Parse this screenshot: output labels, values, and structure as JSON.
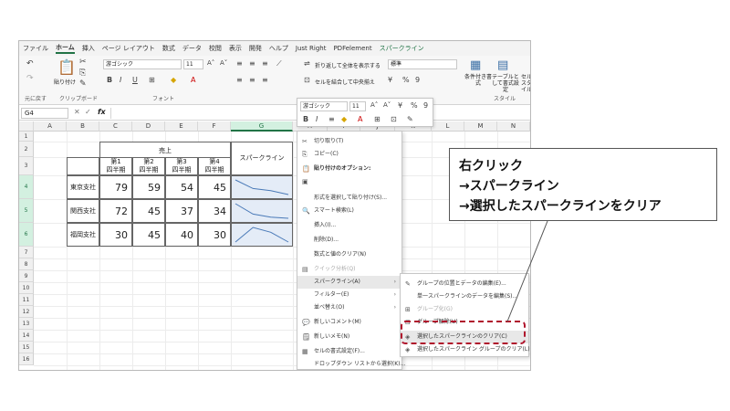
{
  "menu_tabs": [
    "ファイル",
    "ホーム",
    "挿入",
    "ページ レイアウト",
    "数式",
    "データ",
    "校閲",
    "表示",
    "開発",
    "ヘルプ",
    "Just Right",
    "PDFelement",
    "スパークライン"
  ],
  "ribbon": {
    "undo_label": "元に戻す",
    "clipboard_label": "クリップボード",
    "paste_label": "貼り付け",
    "font_label": "フォント",
    "style_label": "スタイル",
    "font_name": "游ゴシック",
    "font_size": "11",
    "wrap_text": "折り返して全体を表示する",
    "merge_center": "セルを結合して中央揃え",
    "number_format": "標準",
    "cond_format": "条件付き書式",
    "table_format": "テーブルとして書式設定",
    "cell_style": "セル スタイル"
  },
  "formula_bar": {
    "name_box": "G4",
    "fx": "fx"
  },
  "columns": [
    "A",
    "B",
    "C",
    "D",
    "E",
    "F",
    "G",
    "H",
    "I",
    "J",
    "K",
    "L",
    "M",
    "N"
  ],
  "rows": [
    "1",
    "2",
    "3",
    "4",
    "5",
    "6",
    "7",
    "8",
    "9",
    "10",
    "11",
    "12",
    "13",
    "14",
    "15",
    "16"
  ],
  "table": {
    "header_sales": "売上",
    "header_sparkline": "スパークライン",
    "quarters": [
      {
        "q": "第1",
        "half": "四半期"
      },
      {
        "q": "第2",
        "half": "四半期"
      },
      {
        "q": "第3",
        "half": "四半期"
      },
      {
        "q": "第4",
        "half": "四半期"
      }
    ],
    "branches": [
      {
        "name": "東京支社",
        "values": [
          "79",
          "59",
          "54",
          "45"
        ]
      },
      {
        "name": "関西支社",
        "values": [
          "72",
          "45",
          "37",
          "34"
        ]
      },
      {
        "name": "福岡支社",
        "values": [
          "30",
          "45",
          "40",
          "30"
        ]
      }
    ]
  },
  "mini_toolbar": {
    "font": "游ゴシック",
    "size": "11"
  },
  "context_menu": [
    {
      "icon": "cut-icon",
      "glyph": "✂",
      "label": "切り取り(T)"
    },
    {
      "icon": "copy-icon",
      "glyph": "⎘",
      "label": "コピー(C)"
    },
    {
      "icon": "paste-icon",
      "glyph": "📋",
      "label": "貼り付けのオプション:",
      "bold": true
    },
    {
      "icon": "paste-option-icon",
      "glyph": "▣",
      "label": ""
    },
    {
      "icon": "",
      "glyph": "",
      "label": "形式を選択して貼り付け(S)..."
    },
    {
      "icon": "smart-search-icon",
      "glyph": "🔍",
      "label": "スマート検索(L)"
    },
    {
      "icon": "",
      "glyph": "",
      "label": "挿入(I)..."
    },
    {
      "icon": "",
      "glyph": "",
      "label": "削除(D)..."
    },
    {
      "icon": "",
      "glyph": "",
      "label": "数式と値のクリア(N)"
    },
    {
      "icon": "quick-analysis-icon",
      "glyph": "▤",
      "label": "クイック分析(Q)",
      "disabled": true
    },
    {
      "icon": "",
      "glyph": "",
      "label": "スパークライン(A)",
      "arrow": "›",
      "highlighted": true
    },
    {
      "icon": "",
      "glyph": "",
      "label": "フィルター(E)",
      "arrow": "›"
    },
    {
      "icon": "",
      "glyph": "",
      "label": "並べ替え(O)",
      "arrow": "›"
    },
    {
      "icon": "new-comment-icon",
      "glyph": "💬",
      "label": "新しいコメント(M)"
    },
    {
      "icon": "new-note-icon",
      "glyph": "🗒",
      "label": "新しいメモ(N)"
    },
    {
      "icon": "format-cells-icon",
      "glyph": "▦",
      "label": "セルの書式設定(F)..."
    },
    {
      "icon": "",
      "glyph": "",
      "label": "ドロップダウン リストから選択(K)..."
    }
  ],
  "submenu": [
    {
      "icon": "edit-group-icon",
      "glyph": "✎",
      "label": "グループの位置とデータの編集(E)..."
    },
    {
      "icon": "",
      "glyph": "",
      "label": "単一スパークラインのデータを編集(S)..."
    },
    {
      "icon": "group-icon",
      "glyph": "⊞",
      "label": "グループ化(G)",
      "disabled": true
    },
    {
      "icon": "ungroup-icon",
      "glyph": "⊟",
      "label": "グループ解除(U)"
    },
    {
      "icon": "clear-sparkline-icon",
      "glyph": "◈",
      "label": "選択したスパークラインのクリア(C)",
      "highlighted": true
    },
    {
      "icon": "clear-group-icon",
      "glyph": "◈",
      "label": "選択したスパークライン グループのクリア(L)"
    }
  ],
  "callout": {
    "line1": "右クリック",
    "line2": "→スパークライン",
    "line3": "→選択したスパークラインをクリア"
  },
  "colors": {
    "accent": "#217346",
    "highlight_border": "#b0132c",
    "sparkline_fill": "#e4ecf7",
    "sparkline_line": "#4a7ab8"
  },
  "sparkline_values": [
    [
      79,
      59,
      54,
      45
    ],
    [
      72,
      45,
      37,
      34
    ],
    [
      30,
      45,
      40,
      30
    ]
  ]
}
